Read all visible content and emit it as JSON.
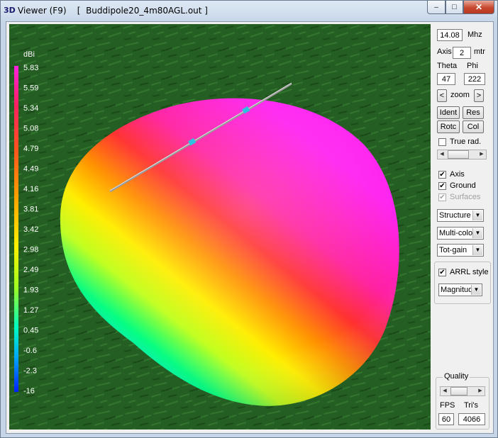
{
  "window": {
    "title_icon": "3D",
    "title": "Viewer (F9)    [  Buddipole20_4m80AGL.out ]",
    "minimize_glyph": "–",
    "maximize_glyph": "□",
    "close_glyph": "✕"
  },
  "legend": {
    "unit": "dBi",
    "values": [
      "5.83",
      "5.59",
      "5.34",
      "5.08",
      "4.79",
      "4.49",
      "4.16",
      "3.81",
      "3.42",
      "2.98",
      "2.49",
      "1.93",
      "1.27",
      "0.45",
      "-0.6",
      "-2.3",
      "-16"
    ],
    "gradient_colors": [
      "#ff20e0",
      "#ff2060",
      "#ff5020",
      "#ffa000",
      "#fff000",
      "#a0ff20",
      "#00ffc0",
      "#00a0ff",
      "#0020ff"
    ]
  },
  "panel": {
    "freq_value": "14.08",
    "freq_unit": "Mhz",
    "axis_label": "Axis",
    "axis_value": "2",
    "axis_unit": "mtr",
    "theta_label": "Theta",
    "phi_label": "Phi",
    "theta_value": "47",
    "phi_value": "222",
    "zoom_prev": "<",
    "zoom_label": "zoom",
    "zoom_next": ">",
    "ident_label": "Ident",
    "res_label": "Res",
    "rotc_label": "Rotc",
    "col_label": "Col",
    "true_rad_label": "True rad.",
    "true_rad_checked": "",
    "axis_check_label": "Axis",
    "axis_checked": "✔",
    "ground_label": "Ground",
    "ground_checked": "✔",
    "surfaces_label": "Surfaces",
    "surfaces_checked": "✔",
    "dropdown_structure": "Structure",
    "dropdown_color": "Multi-color",
    "dropdown_gain": "Tot-gain",
    "arrl_label": "ARRL style",
    "arrl_checked": "✔",
    "dropdown_magnitude": "Magnitude",
    "quality_label": "Quality",
    "fps_label": "FPS",
    "tris_label": "Tri's",
    "fps_value": "60",
    "tris_value": "4066"
  }
}
